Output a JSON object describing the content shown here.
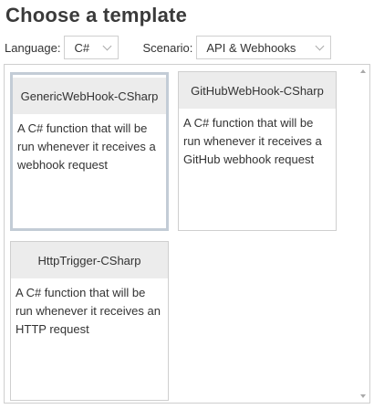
{
  "page": {
    "title": "Choose a template"
  },
  "filters": {
    "language_label": "Language:",
    "language_value": "C#",
    "scenario_label": "Scenario:",
    "scenario_value": "API & Webhooks"
  },
  "templates": [
    {
      "name": "GenericWebHook-CSharp",
      "description": "A C# function that will be run whenever it receives a webhook request",
      "selected": true
    },
    {
      "name": "GitHubWebHook-CSharp",
      "description": "A C# function that will be run whenever it receives a GitHub webhook request",
      "selected": false
    },
    {
      "name": "HttpTrigger-CSharp",
      "description": "A C# function that will be run whenever it receives an HTTP request",
      "selected": false
    }
  ]
}
